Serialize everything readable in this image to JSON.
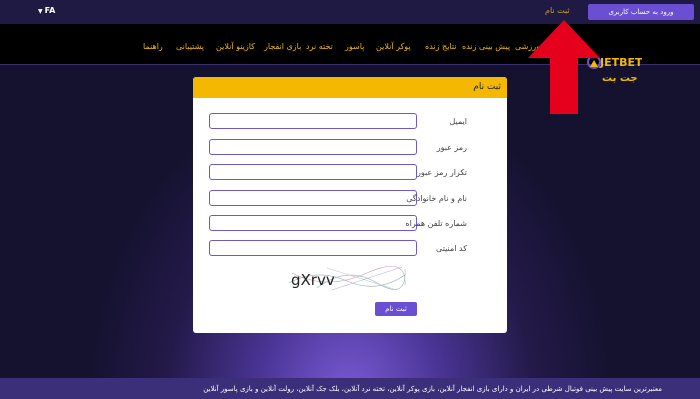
{
  "topbar": {
    "language": "FA",
    "signup_link": "ثبت نام",
    "login_button": "ورود به حساب کاربری"
  },
  "brand": {
    "logo_text_top": "JETBET",
    "logo_text_bottom": "جت بت"
  },
  "nav": {
    "items": [
      "راهنما",
      "پشتیبانی",
      "کازینو آنلاین",
      "بازی انفجار",
      "پوکر آنلاین",
      "پاسور",
      "تخته نرد",
      "بازی انفجار",
      "نتایج زنده",
      "پیش بینی زنده",
      "ورزشی"
    ]
  },
  "form": {
    "title": "ثبت نام",
    "labels": {
      "email": "ایمیل",
      "password": "رمز عبور",
      "password_repeat": "تکرار رمز عبور",
      "full_name": "نام و نام خانوادگی",
      "phone": "شماره تلفن همراه",
      "security_code": "کد امنیتی"
    },
    "captcha_text": "gXrvv",
    "submit": "ثبت نام"
  },
  "footer": {
    "text": "معتبرترین سایت پیش بینی فوتبال شرطی در ایران و دارای بازی انفجار آنلاین، بازی پوکر آنلاین، تخته نرد آنلاین، بلک جک آنلاین، رولت آنلاین و بازی پاسور آنلاین"
  }
}
